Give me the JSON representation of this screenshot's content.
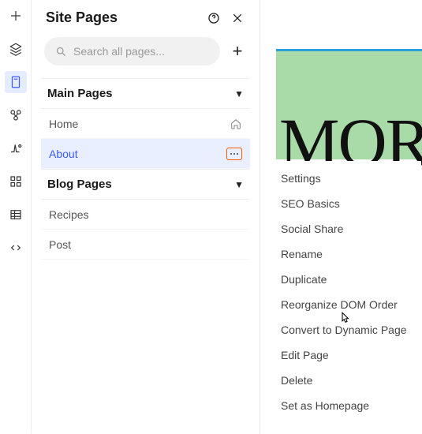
{
  "panel": {
    "title": "Site Pages",
    "search_placeholder": "Search all pages...",
    "sections": [
      {
        "label": "Main Pages"
      },
      {
        "label": "Blog Pages"
      }
    ],
    "main_pages": [
      {
        "label": "Home"
      },
      {
        "label": "About"
      }
    ],
    "blog_pages": [
      {
        "label": "Recipes"
      },
      {
        "label": "Post"
      }
    ]
  },
  "canvas": {
    "headline_fragment": "MOR"
  },
  "context_menu": {
    "items": [
      "Settings",
      "SEO Basics",
      "Social Share",
      "Rename",
      "Duplicate",
      "Reorganize DOM Order",
      "Convert to Dynamic Page",
      "Edit Page",
      "Delete",
      "Set as Homepage"
    ]
  }
}
